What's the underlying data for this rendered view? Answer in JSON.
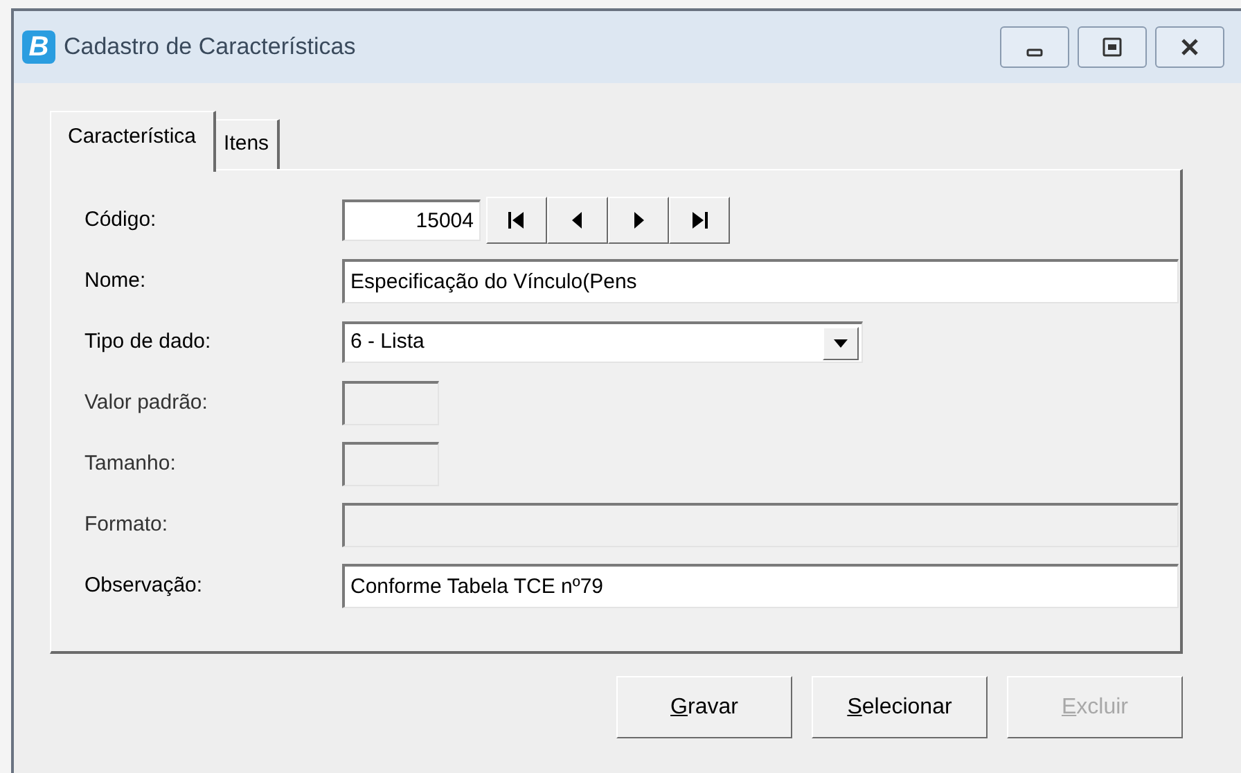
{
  "window": {
    "title": "Cadastro de Características",
    "logo": "B"
  },
  "tabs": [
    {
      "label": "Característica",
      "selected": true
    },
    {
      "label": "Itens",
      "selected": false
    }
  ],
  "form": {
    "fields": [
      {
        "kind": "code",
        "label": "Código:",
        "value": "15004",
        "disabled": false
      },
      {
        "kind": "text",
        "label": "Nome:",
        "value": "Especificação do Vínculo(Pens",
        "disabled": false
      },
      {
        "kind": "select",
        "label": "Tipo de dado:",
        "value": "6 - Lista",
        "disabled": false
      },
      {
        "kind": "short",
        "label": "Valor padrão:",
        "disabled": true
      },
      {
        "kind": "short",
        "label": "Tamanho:",
        "disabled": true
      },
      {
        "kind": "text",
        "label": "Formato:",
        "disabled": true
      },
      {
        "kind": "text",
        "label": "Observação:",
        "value": "Conforme Tabela TCE nº79",
        "disabled": false
      }
    ]
  },
  "buttons": [
    {
      "label": "Gravar",
      "disabled": false
    },
    {
      "label": "Selecionar",
      "disabled": false
    },
    {
      "label": "Excluir",
      "disabled": true
    }
  ]
}
